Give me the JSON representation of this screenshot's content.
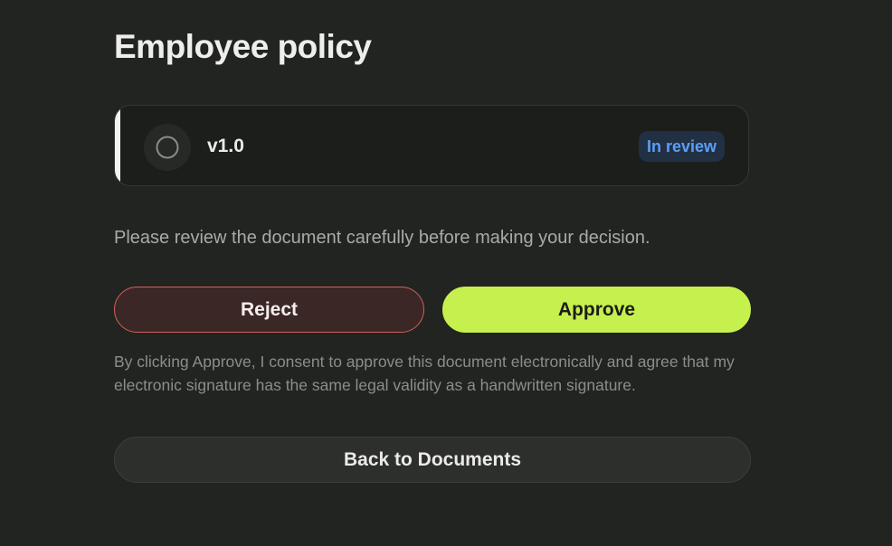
{
  "page": {
    "title": "Employee policy"
  },
  "version_card": {
    "version": "v1.0",
    "status": "In review",
    "status_color": "#5b9ff5",
    "status_icon": "empty-circle-icon"
  },
  "instruction": "Please review the document carefully before making your decision.",
  "actions": {
    "reject_label": "Reject",
    "approve_label": "Approve",
    "reject_color": "#d0605a",
    "approve_color": "#c6f04e"
  },
  "consent_text": "By clicking Approve, I consent to approve this document electronically and agree that my electronic signature has the same legal validity as a handwritten signature.",
  "back_label": "Back to Documents"
}
